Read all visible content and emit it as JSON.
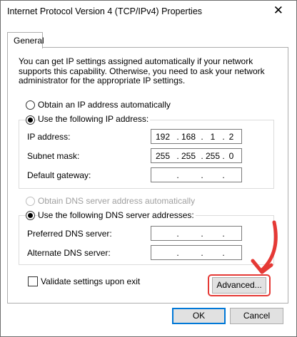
{
  "window": {
    "title": "Internet Protocol Version 4 (TCP/IPv4) Properties",
    "close_glyph": "✕"
  },
  "tabs": [
    {
      "label": "General"
    }
  ],
  "description": "You can get IP settings assigned automatically if your network supports this capability. Otherwise, you need to ask your network administrator for the appropriate IP settings.",
  "ip_section": {
    "auto_label": "Obtain an IP address automatically",
    "manual_label": "Use the following IP address:",
    "selected": "manual",
    "fields": [
      {
        "label": "IP address:",
        "octets": [
          "192",
          "168",
          "1",
          "2"
        ]
      },
      {
        "label": "Subnet mask:",
        "octets": [
          "255",
          "255",
          "255",
          "0"
        ]
      },
      {
        "label": "Default gateway:",
        "octets": [
          "",
          "",
          "",
          ""
        ]
      }
    ]
  },
  "dns_section": {
    "auto_label": "Obtain DNS server address automatically",
    "manual_label": "Use the following DNS server addresses:",
    "selected": "manual",
    "fields": [
      {
        "label": "Preferred DNS server:",
        "octets": [
          "",
          "",
          "",
          ""
        ]
      },
      {
        "label": "Alternate DNS server:",
        "octets": [
          "",
          "",
          "",
          ""
        ]
      }
    ]
  },
  "validate_label": "Validate settings upon exit",
  "validate_checked": false,
  "buttons": {
    "advanced": "Advanced...",
    "ok": "OK",
    "cancel": "Cancel"
  },
  "colors": {
    "highlight": "#e53935",
    "accent": "#0078d7",
    "button_face": "#e1e1e1"
  }
}
